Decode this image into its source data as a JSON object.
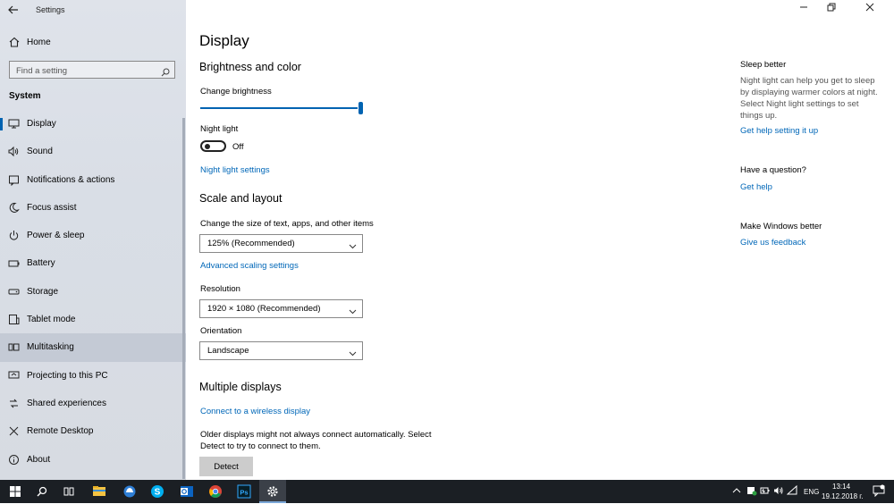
{
  "app_title": "Settings",
  "sidebar": {
    "home_label": "Home",
    "search_placeholder": "Find a setting",
    "section": "System",
    "items": [
      {
        "label": "Display",
        "icon": "monitor-icon"
      },
      {
        "label": "Sound",
        "icon": "speaker-icon"
      },
      {
        "label": "Notifications & actions",
        "icon": "notification-icon"
      },
      {
        "label": "Focus assist",
        "icon": "moon-icon"
      },
      {
        "label": "Power & sleep",
        "icon": "power-icon"
      },
      {
        "label": "Battery",
        "icon": "battery-icon"
      },
      {
        "label": "Storage",
        "icon": "storage-icon"
      },
      {
        "label": "Tablet mode",
        "icon": "tablet-icon"
      },
      {
        "label": "Multitasking",
        "icon": "multitasking-icon"
      },
      {
        "label": "Projecting to this PC",
        "icon": "project-icon"
      },
      {
        "label": "Shared experiences",
        "icon": "shared-icon"
      },
      {
        "label": "Remote Desktop",
        "icon": "remote-icon"
      },
      {
        "label": "About",
        "icon": "info-icon"
      }
    ]
  },
  "main": {
    "title": "Display",
    "brightness": {
      "heading": "Brightness and color",
      "slider_label": "Change brightness",
      "slider_value": 1.0,
      "night_light_label": "Night light",
      "night_light_state": "Off",
      "night_light_link": "Night light settings"
    },
    "scale": {
      "heading": "Scale and layout",
      "size_label": "Change the size of text, apps, and other items",
      "size_value": "125% (Recommended)",
      "advanced_link": "Advanced scaling settings",
      "resolution_label": "Resolution",
      "resolution_value": "1920 × 1080 (Recommended)",
      "orientation_label": "Orientation",
      "orientation_value": "Landscape"
    },
    "multiple": {
      "heading": "Multiple displays",
      "wireless_link": "Connect to a wireless display",
      "description": "Older displays might not always connect automatically. Select Detect to try to connect to them.",
      "detect_button": "Detect"
    }
  },
  "right_panel": {
    "sleep_heading": "Sleep better",
    "sleep_text": "Night light can help you get to sleep by displaying warmer colors at night. Select Night light settings to set things up.",
    "sleep_link": "Get help setting it up",
    "question_heading": "Have a question?",
    "question_link": "Get help",
    "feedback_heading": "Make Windows better",
    "feedback_link": "Give us feedback"
  },
  "taskbar": {
    "language": "ENG",
    "time": "13:14",
    "date": "19.12.2018 г."
  },
  "colors": {
    "accent": "#0063b1",
    "link": "#0067b8",
    "taskbar": "#1b1f24"
  }
}
